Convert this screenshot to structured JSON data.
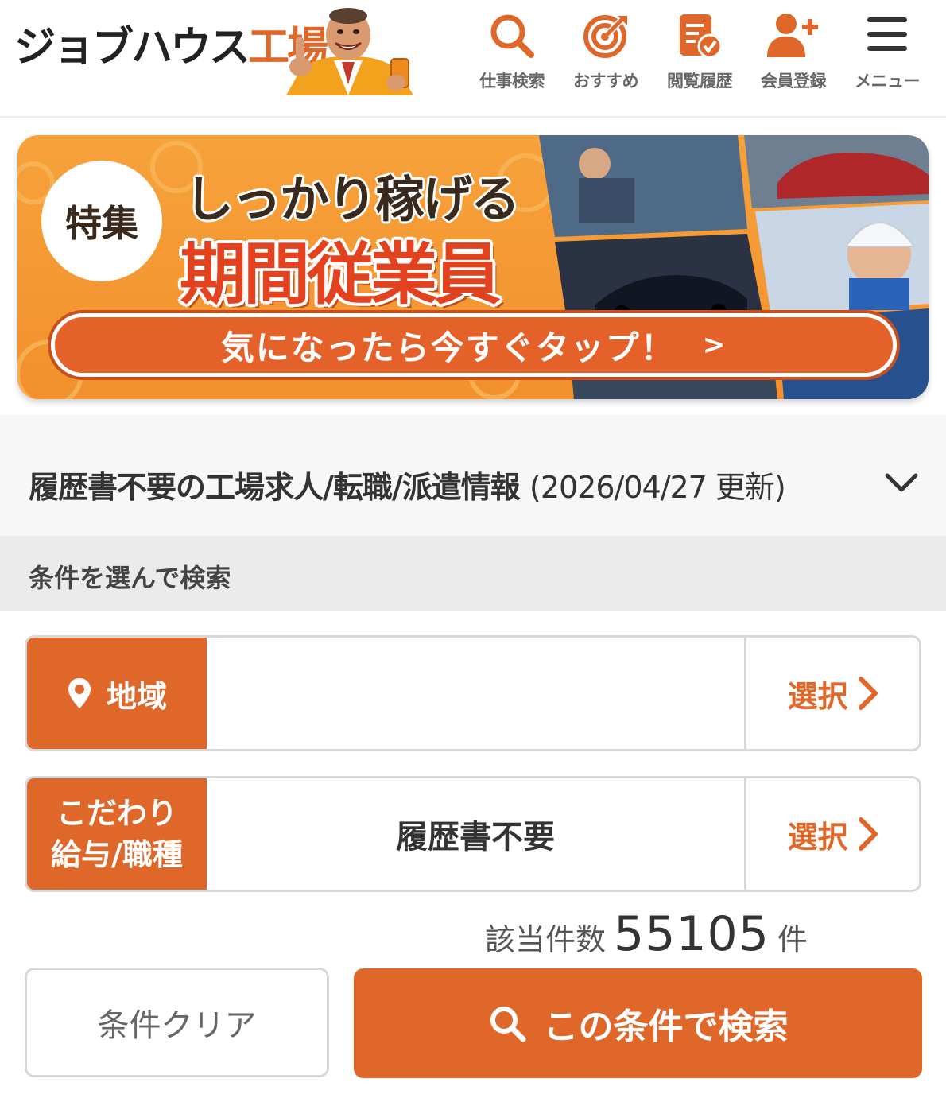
{
  "header": {
    "logo_main": "ジョブハウス",
    "logo_accent": "工場",
    "nav": [
      {
        "label": "仕事検索",
        "icon": "search-icon"
      },
      {
        "label": "おすすめ",
        "icon": "target-icon"
      },
      {
        "label": "閲覧履歴",
        "icon": "history-document-icon"
      },
      {
        "label": "会員登録",
        "icon": "add-user-icon"
      },
      {
        "label": "メニュー",
        "icon": "hamburger-menu-icon"
      }
    ]
  },
  "banner": {
    "badge": "特集",
    "line1": "しっかり稼げる",
    "line2": "期間従業員",
    "cta": "気になったら今すぐタップ！",
    "cta_chevron": ">"
  },
  "page_heading": {
    "title": "履歴書不要の工場求人/転職/派遣情報",
    "updated": "(2026/04/27 更新)"
  },
  "search_section": {
    "label": "条件を選んで検索",
    "area": {
      "label": "地域",
      "value": "",
      "select": "選択"
    },
    "kodawari": {
      "label_line1": "こだわり",
      "label_line2": "給与/職種",
      "value": "履歴書不要",
      "select": "選択"
    },
    "count_label": "該当件数",
    "count": "55105",
    "count_unit": "件",
    "clear_button": "条件クリア",
    "search_button": "この条件で検索"
  },
  "colors": {
    "accent": "#e0672a",
    "banner_orange": "#f2902d",
    "banner_red_text": "#e2421d"
  }
}
